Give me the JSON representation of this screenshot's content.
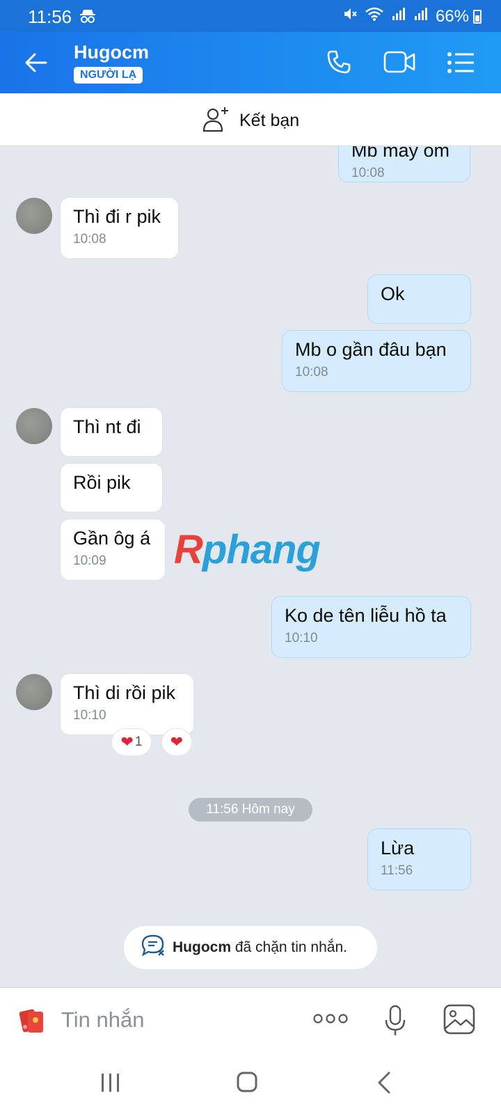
{
  "status_bar": {
    "time": "11:56",
    "battery": "66%"
  },
  "header": {
    "title": "Hugocm",
    "badge": "NGƯỜI LẠ"
  },
  "add_friend": {
    "label": "Kết bạn"
  },
  "messages": [
    {
      "text": "Mb máy om",
      "time": "10:08"
    },
    {
      "text": "Thì đi r pik",
      "time": "10:08"
    },
    {
      "text": "Ok"
    },
    {
      "text": "Mb o gần đâu bạn",
      "time": "10:08"
    },
    {
      "text": "Thì nt đi"
    },
    {
      "text": "Rồi pik"
    },
    {
      "text": "Gần ôg á",
      "time": "10:09"
    },
    {
      "text": "Ko de tên liễu hồ ta",
      "time": "10:10"
    },
    {
      "text": "Thì di rồi pik",
      "time": "10:10"
    },
    {
      "text": "Lừa",
      "time": "11:56"
    }
  ],
  "reactions": {
    "count": "1"
  },
  "date_separator": "11:56 Hôm nay",
  "blocked_notice": {
    "name": "Hugocm",
    "text": "đã chặn tin nhắn."
  },
  "watermark": {
    "part1": "R",
    "part2": "phang"
  },
  "input": {
    "placeholder": "Tin nhắn"
  },
  "colors": {
    "header": "#1a73e8",
    "outgoing_bubble": "#d5ecfd",
    "incoming_bubble": "#ffffff",
    "chat_bg": "#e3e8ef"
  }
}
